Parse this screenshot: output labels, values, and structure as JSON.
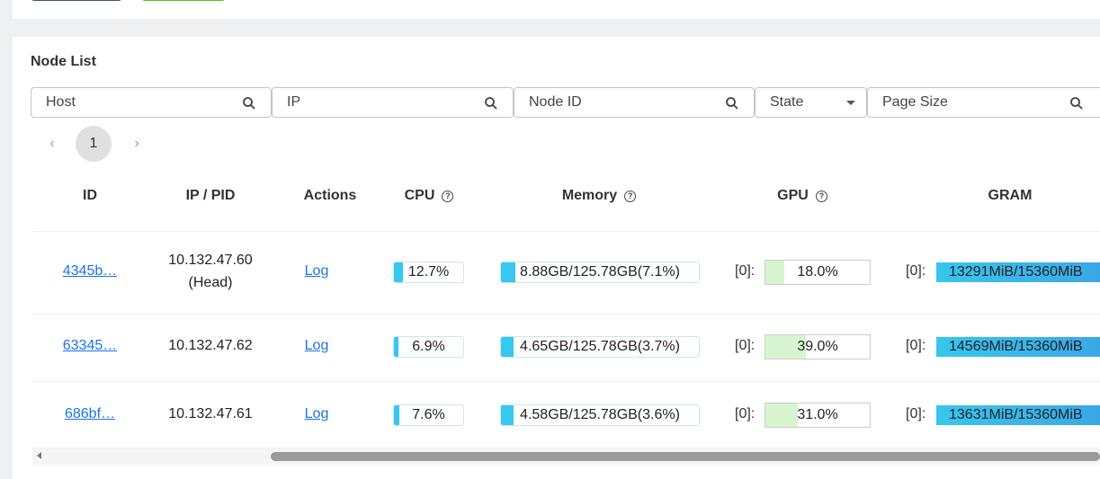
{
  "top_buttons": [
    {
      "color": "#3a5570"
    },
    {
      "color": "#52c41a"
    }
  ],
  "node_list": {
    "title": "Node List",
    "filters": {
      "host_placeholder": "Host",
      "ip_placeholder": "IP",
      "node_id_placeholder": "Node ID",
      "state_label": "State",
      "page_size_placeholder": "Page Size"
    },
    "pagination": {
      "prev": "‹",
      "current": "1",
      "next": "›"
    },
    "columns": [
      "ID",
      "IP / PID",
      "Actions",
      "CPU",
      "Memory",
      "GPU",
      "GRAM"
    ],
    "rows": [
      {
        "id": "4345b…",
        "ip": "10.132.47.60",
        "role": "(Head)",
        "action": "Log",
        "cpu": {
          "text": "12.7%",
          "pct": 12.7
        },
        "memory": {
          "text": "8.88GB/125.78GB(7.1%)",
          "pct": 7.1
        },
        "gpu_index": "[0]:",
        "gpu": {
          "text": "18.0%",
          "pct": 18.0
        },
        "gram_index": "[0]:",
        "gram": {
          "text": "13291MiB/15360MiB"
        }
      },
      {
        "id": "63345…",
        "ip": "10.132.47.62",
        "role": "",
        "action": "Log",
        "cpu": {
          "text": "6.9%",
          "pct": 6.9
        },
        "memory": {
          "text": "4.65GB/125.78GB(3.7%)",
          "pct": 3.7
        },
        "gpu_index": "[0]:",
        "gpu": {
          "text": "39.0%",
          "pct": 39.0
        },
        "gram_index": "[0]:",
        "gram": {
          "text": "14569MiB/15360MiB"
        }
      },
      {
        "id": "686bf…",
        "ip": "10.132.47.61",
        "role": "",
        "action": "Log",
        "cpu": {
          "text": "7.6%",
          "pct": 7.6
        },
        "memory": {
          "text": "4.58GB/125.78GB(3.6%)",
          "pct": 3.6
        },
        "gpu_index": "[0]:",
        "gpu": {
          "text": "31.0%",
          "pct": 31.0
        },
        "gram_index": "[0]:",
        "gram": {
          "text": "13631MiB/15360MiB"
        }
      }
    ]
  },
  "colors": {
    "accent": "#36c8ef",
    "link": "#1a73e8",
    "gpu_fill": "#d7f6d0"
  },
  "icons": {
    "search": "search-icon",
    "dropdown": "caret-down-icon",
    "help": "help-circle-icon"
  }
}
